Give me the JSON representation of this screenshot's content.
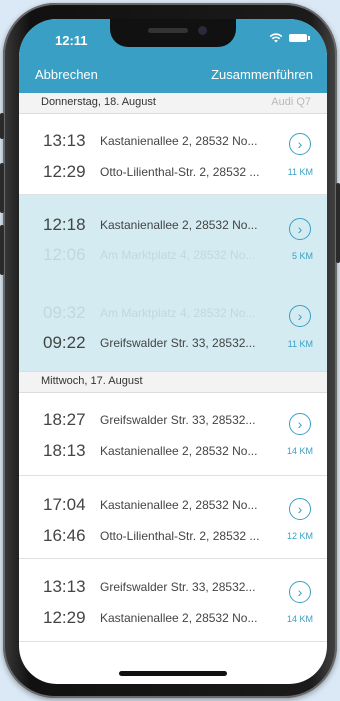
{
  "status": {
    "time": "12:11"
  },
  "nav": {
    "cancel": "Abbrechen",
    "merge": "Zusammenführen"
  },
  "sections": [
    {
      "label": "Donnerstag, 18. August",
      "car": "Audi Q7"
    },
    {
      "label": "Mittwoch, 17. August"
    }
  ],
  "trips": [
    {
      "start_time": "13:13",
      "start_addr": "Kastanienallee 2, 28532 No...",
      "end_time": "12:29",
      "end_addr": "Otto-Lilienthal-Str. 2, 28532 ...",
      "km": "11 KM",
      "highlight": false
    },
    {
      "start_time": "12:18",
      "start_addr": "Kastanienallee 2, 28532 No...",
      "end_time": "12:06",
      "end_addr": "Am Marktplatz 4, 28532 No...",
      "km": "5 KM",
      "highlight": true
    },
    {
      "start_time": "09:32",
      "start_addr": "Am Marktplatz 4, 28532 No...",
      "end_time": "09:22",
      "end_addr": "Greifswalder Str. 33, 28532...",
      "km": "11 KM",
      "highlight": true
    },
    {
      "start_time": "18:27",
      "start_addr": "Greifswalder Str. 33, 28532...",
      "end_time": "18:13",
      "end_addr": "Kastanienallee 2, 28532 No...",
      "km": "14 KM",
      "highlight": false
    },
    {
      "start_time": "17:04",
      "start_addr": "Kastanienallee 2, 28532 No...",
      "end_time": "16:46",
      "end_addr": "Otto-Lilienthal-Str. 2, 28532 ...",
      "km": "12 KM",
      "highlight": false
    },
    {
      "start_time": "13:13",
      "start_addr": "Greifswalder Str. 33, 28532...",
      "end_time": "12:29",
      "end_addr": "Kastanienallee 2, 28532 No...",
      "km": "14 KM",
      "highlight": false
    }
  ],
  "colors": {
    "accent": "#3a9fc4",
    "highlight_bg": "#d4ebf2",
    "faded_text": "#c2d8df"
  },
  "icons": {
    "detail": "chevron-right-circle-icon"
  }
}
